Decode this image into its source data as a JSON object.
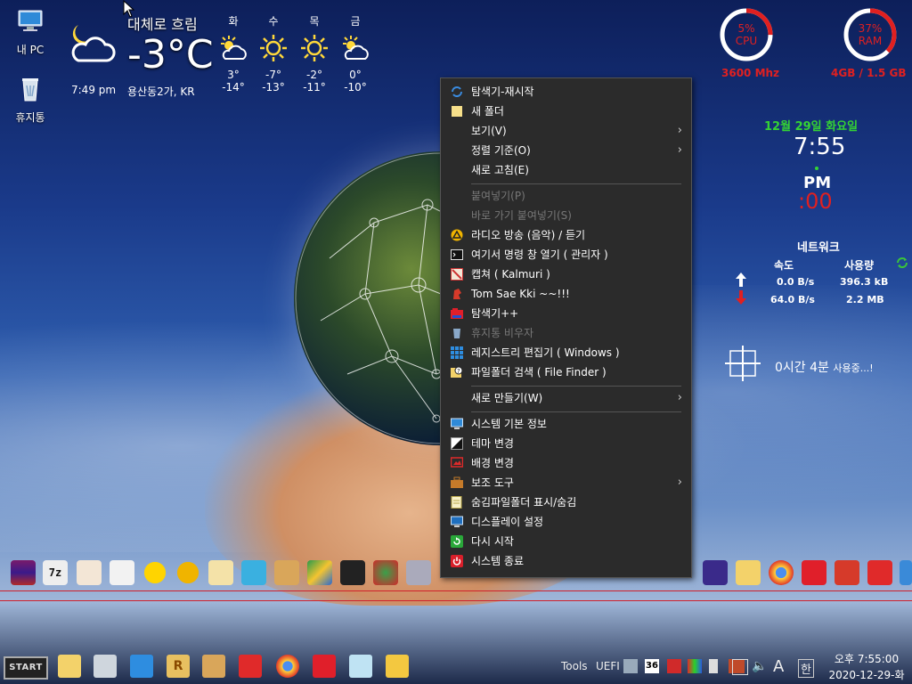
{
  "desktop": {
    "icons": [
      {
        "label": "내 PC"
      },
      {
        "label": "휴지통"
      }
    ]
  },
  "weather": {
    "condition": "대체로 흐림",
    "temperature": "-3°C",
    "time": "7:49 pm",
    "location": "용산동2가,  KR",
    "forecast": [
      {
        "day": "화",
        "high": "3°",
        "low": "-14°",
        "icon": "partly-cloudy-icon"
      },
      {
        "day": "수",
        "high": "-7°",
        "low": "-13°",
        "icon": "sunny-icon"
      },
      {
        "day": "목",
        "high": "-2°",
        "low": "-11°",
        "icon": "sunny-icon"
      },
      {
        "day": "금",
        "high": "0°",
        "low": "-10°",
        "icon": "partly-cloudy-icon"
      }
    ]
  },
  "system": {
    "cpu": {
      "percent_label": "5%",
      "name": "CPU",
      "percent": 5,
      "speed": "3600 Mhz"
    },
    "ram": {
      "percent_label": "37%",
      "name": "RAM",
      "percent": 37,
      "usage": "4GB /  1.5 GB"
    },
    "accent_red": "#e02020"
  },
  "clock": {
    "date": "12월 29일 화요일",
    "time": "7:55",
    "ampm": "PM",
    "seconds": ":00"
  },
  "network": {
    "title": "네트워크",
    "speed_header": "속도",
    "usage_header": "사용량",
    "upload_speed": "0.0 B/s",
    "upload_usage": "396.3 kB",
    "download_speed": "64.0 B/s",
    "download_usage": "2.2 MB"
  },
  "uptime": {
    "value": "0시간 4분",
    "suffix": "사용중...!"
  },
  "context_menu": {
    "items": [
      {
        "label": "탐색기-재시작",
        "icon": "refresh-icon",
        "enabled": true
      },
      {
        "label": "새 폴더",
        "icon": "folder-icon",
        "enabled": true
      },
      {
        "label": "보기(V)",
        "icon": "",
        "enabled": true,
        "submenu": true
      },
      {
        "label": "정렬 기준(O)",
        "icon": "",
        "enabled": true,
        "submenu": true
      },
      {
        "label": "새로 고침(E)",
        "icon": "",
        "enabled": true
      },
      {
        "label": "붙여넣기(P)",
        "icon": "",
        "enabled": false
      },
      {
        "label": "바로 가기 붙여넣기(S)",
        "icon": "",
        "enabled": false
      },
      {
        "label": "라디오 방송 (음악) / 듣기",
        "icon": "radio-icon",
        "enabled": true
      },
      {
        "label": "여기서 명령 창 열기 ( 관리자 )",
        "icon": "terminal-icon",
        "enabled": true
      },
      {
        "label": "캡쳐 ( Kalmuri )",
        "icon": "capture-icon",
        "enabled": true
      },
      {
        "label": "Tom Sae Kki ~~!!!",
        "icon": "tom-icon",
        "enabled": true
      },
      {
        "label": "탐색기++",
        "icon": "explorer-plus-icon",
        "enabled": true
      },
      {
        "label": "휴지통 비우자",
        "icon": "recycle-bin-icon",
        "enabled": false
      },
      {
        "label": "레지스트리 편집기 ( Windows )",
        "icon": "registry-icon",
        "enabled": true
      },
      {
        "label": "파일폴더 검색 ( File Finder )",
        "icon": "file-finder-icon",
        "enabled": true
      },
      {
        "label": "새로 만들기(W)",
        "icon": "",
        "enabled": true,
        "submenu": true
      },
      {
        "label": "시스템 기본 정보",
        "icon": "monitor-icon",
        "enabled": true
      },
      {
        "label": "테마 변경",
        "icon": "theme-icon",
        "enabled": true
      },
      {
        "label": "배경 변경",
        "icon": "wallpaper-icon",
        "enabled": true
      },
      {
        "label": "보조 도구",
        "icon": "toolbox-icon",
        "enabled": true,
        "submenu": true
      },
      {
        "label": "숨김파일폴더 표시/숨김",
        "icon": "hidden-files-icon",
        "enabled": true
      },
      {
        "label": "디스플레이 설정",
        "icon": "display-icon",
        "enabled": true
      },
      {
        "label": "다시 시작",
        "icon": "restart-icon",
        "enabled": true
      },
      {
        "label": "시스템 종료",
        "icon": "shutdown-icon",
        "enabled": true
      }
    ]
  },
  "taskbar": {
    "start_label": "START",
    "tools_label": "Tools",
    "uefi_label": "UEFI",
    "badge_36": "36",
    "ime_a": "A",
    "ime_han": "한",
    "tray_time": "오후 7:55:00",
    "tray_date": "2020-12-29-화"
  }
}
